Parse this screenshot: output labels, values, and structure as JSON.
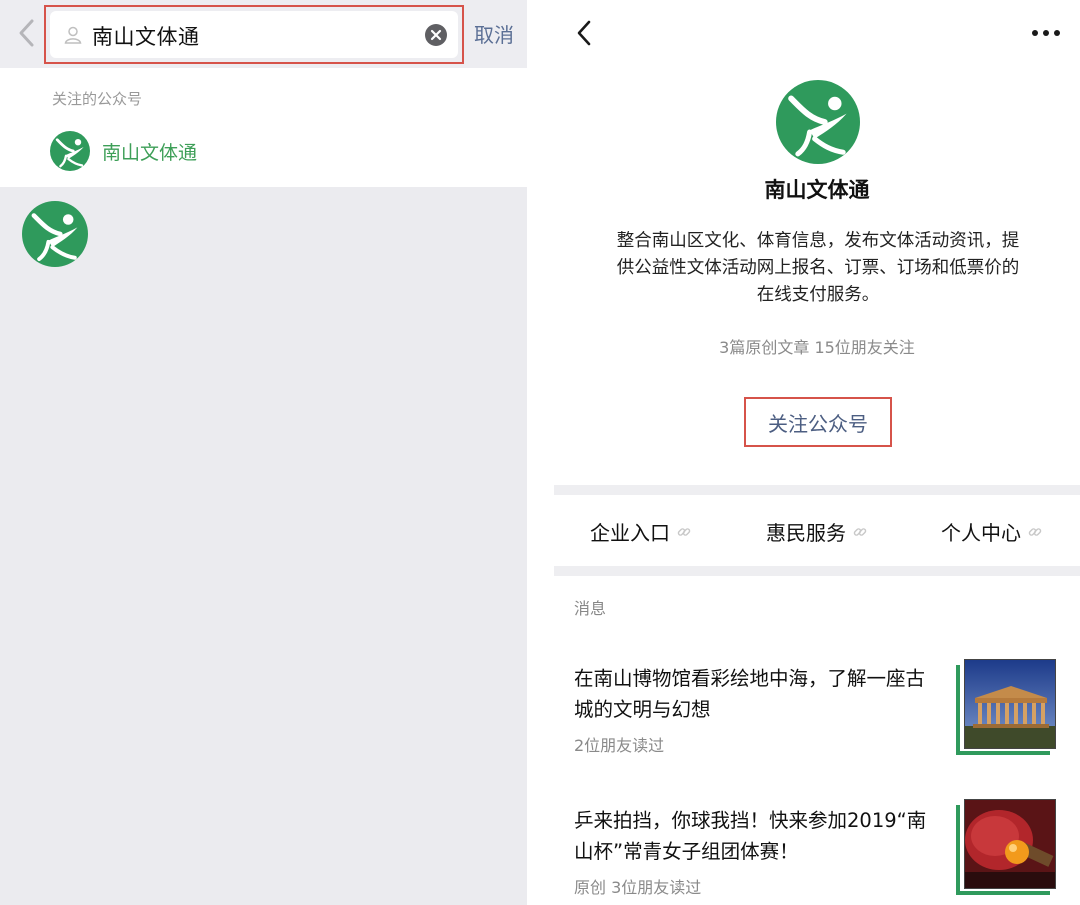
{
  "search": {
    "query": "南山文体通",
    "cancel_label": "取消"
  },
  "results": {
    "section_label": "关注的公众号",
    "items": [
      {
        "name": "南山文体通"
      }
    ]
  },
  "profile": {
    "name": "南山文体通",
    "description": "整合南山区文化、体育信息，发布文体活动资讯，提供公益性文体活动网上报名、订票、订场和低票价的在线支付服务。",
    "stats": "3篇原创文章  15位朋友关注",
    "follow_label": "关注公众号",
    "menu": [
      "企业入口",
      "惠民服务",
      "个人中心"
    ],
    "messages_label": "消息",
    "articles": [
      {
        "title": "在南山博物馆看彩绘地中海，了解一座古城的文明与幻想",
        "meta": "2位朋友读过"
      },
      {
        "title": "乒来拍挡，你球我挡！快来参加2019“南山杯”常青女子组团体赛！",
        "meta": "原创  3位朋友读过"
      }
    ]
  },
  "colors": {
    "brand_green": "#2f9a5c",
    "highlight_red": "#d6534a",
    "link_blue": "#4c5e82"
  }
}
